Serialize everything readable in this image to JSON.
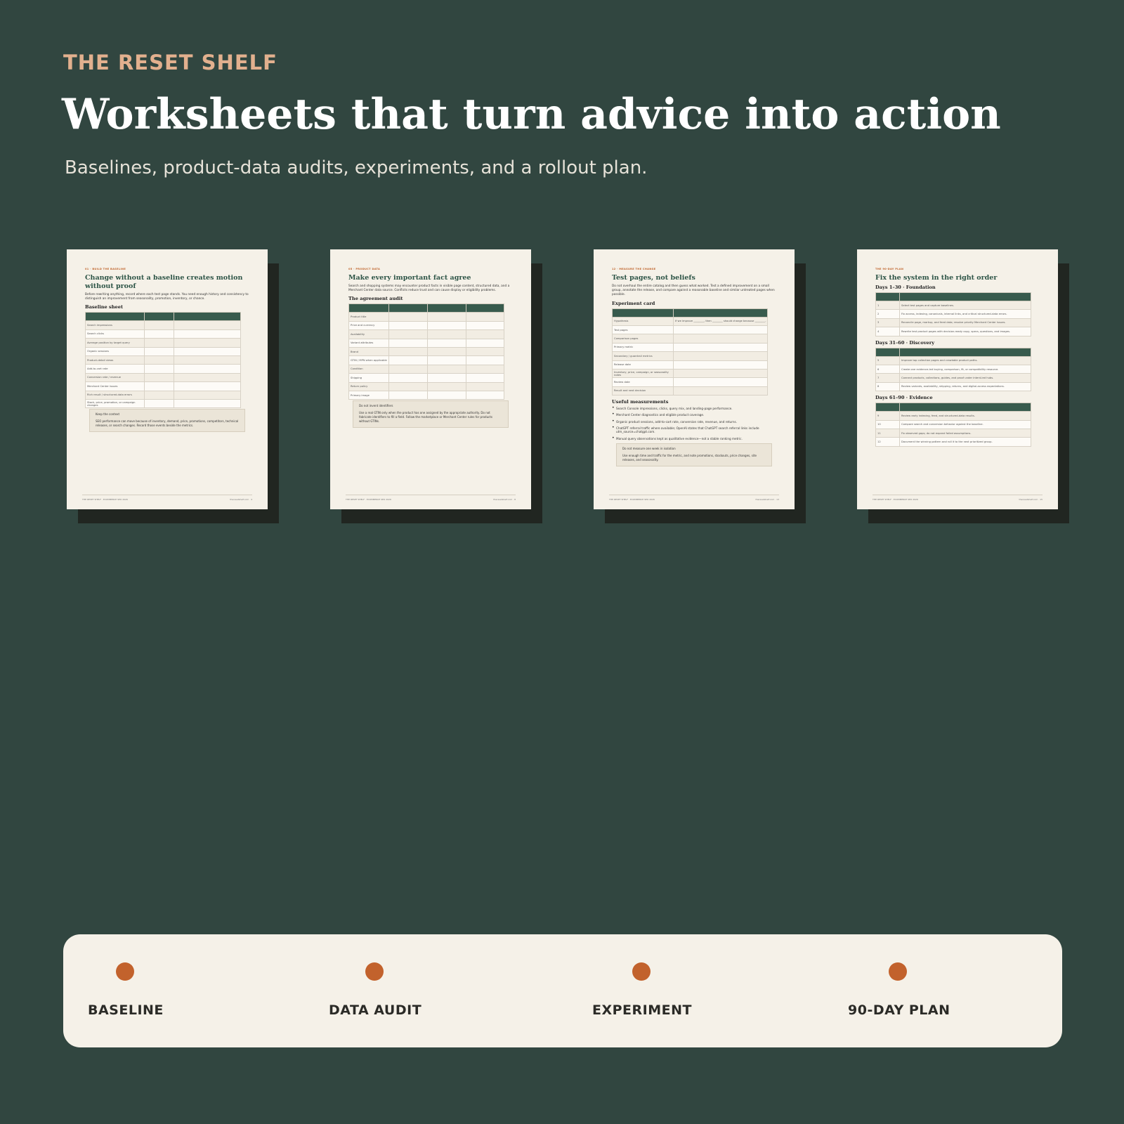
{
  "brand": "THE RESET SHELF",
  "headline": "Worksheets that turn advice into action",
  "subheadline": "Baselines, product-data audits, experiments, and a rollout plan.",
  "pages": [
    {
      "kicker": "01 · BUILD THE BASELINE",
      "title": "Change without a baseline creates motion without proof",
      "intro": "Before rewriting anything, record where each test page stands. You need enough history and consistency to distinguish an improvement from seasonality, promotion, inventory, or chance.",
      "section": "Baseline sheet",
      "rows": [
        "Search impressions",
        "Search clicks",
        "Average position by target query",
        "Organic sessions",
        "Product-detail views",
        "Add-to-cart rate",
        "Conversion rate / revenue",
        "Merchant Center issues",
        "Rich result / structured-data errors",
        "Stock, price, promotion, or campaign changes"
      ],
      "callout_title": "Keep the context",
      "callout_body": "SEO performance can move because of inventory, demand, price, promotions, competitors, technical releases, or search changes. Record those events beside the metrics.",
      "footer_left": "THE RESET SHELF · ECOMMERCE SEO 2026",
      "footer_right": "theresetshelf.com · 4"
    },
    {
      "kicker": "05 · PRODUCT DATA",
      "title": "Make every important fact agree",
      "intro": "Search and shopping systems may encounter product facts in visible page content, structured data, and a Merchant Center data source. Conflicts reduce trust and can cause display or eligibility problems.",
      "section": "The agreement audit",
      "rows": [
        "Product title",
        "Price and currency",
        "Availability",
        "Variant attributes",
        "Brand",
        "GTIN / MPN when applicable",
        "Condition",
        "Shipping",
        "Return policy",
        "Primary image"
      ],
      "callout_title": "Do not invent identifiers",
      "callout_body": "Use a real GTIN only when the product has one assigned by the appropriate authority. Do not fabricate identifiers to fill a field. Follow the marketplace or Merchant Center rules for products without GTINs.",
      "footer_left": "THE RESET SHELF · ECOMMERCE SEO 2026",
      "footer_right": "theresetshelf.com · 8"
    },
    {
      "kicker": "12 · MEASURE THE CHANGE",
      "title": "Test pages, not beliefs",
      "intro": "Do not overhaul the entire catalog and then guess what worked. Test a defined improvement on a small group, annotate the release, and compare against a reasonable baseline and similar untreated pages when possible.",
      "section": "Experiment card",
      "rows": [
        "Hypothesis",
        "Test pages",
        "Comparison pages",
        "Primary metric",
        "Secondary / guardrail metrics",
        "Release date",
        "Inventory, price, campaign, or seasonality notes",
        "Review date",
        "Result and next decision"
      ],
      "hypothesis_text": "If we improve ________, then ________ should change because ________.",
      "section2": "Useful measurements",
      "bullets": [
        "Search Console impressions, clicks, query mix, and landing-page performance.",
        "Merchant Center diagnostics and eligible product coverage.",
        "Organic product sessions, add-to-cart rate, conversion rate, revenue, and returns.",
        "ChatGPT referral traffic where available; OpenAI states that ChatGPT search referral links include utm_source=chatgpt.com.",
        "Manual query observations kept as qualitative evidence—not a stable ranking metric."
      ],
      "callout_title": "Do not measure one week in isolation",
      "callout_body": "Use enough time and traffic for the metric, and note promotions, stockouts, price changes, site releases, and seasonality.",
      "footer_left": "THE RESET SHELF · ECOMMERCE SEO 2026",
      "footer_right": "theresetshelf.com · 13"
    },
    {
      "kicker": "THE 90-DAY PLAN",
      "title": "Fix the system in the right order",
      "phases": [
        {
          "heading": "Days 1–30 · Foundation",
          "rows": [
            {
              "n": "1",
              "t": "Select test pages and capture baselines."
            },
            {
              "n": "2",
              "t": "Fix access, indexing, canonicals, internal links, and critical structured-data errors."
            },
            {
              "n": "3",
              "t": "Reconcile page, markup, and feed data; resolve priority Merchant Center issues."
            },
            {
              "n": "4",
              "t": "Rewrite test product pages with decision-ready copy, specs, questions, and images."
            }
          ]
        },
        {
          "heading": "Days 31–60 · Discovery",
          "rows": [
            {
              "n": "5",
              "t": "Improve top collection pages and crawlable product paths."
            },
            {
              "n": "6",
              "t": "Create one evidence-led buying, comparison, fit, or compatibility resource."
            },
            {
              "n": "7",
              "t": "Connect products, collections, guides, and proof under intent-led hubs."
            },
            {
              "n": "8",
              "t": "Review variants, availability, shipping, returns, and digital-access expectations."
            }
          ]
        },
        {
          "heading": "Days 61–90 · Evidence",
          "rows": [
            {
              "n": "9",
              "t": "Review early indexing, feed, and structured-data results."
            },
            {
              "n": "10",
              "t": "Compare search and conversion behavior against the baseline."
            },
            {
              "n": "11",
              "t": "Fix observed gaps; do not expand failed assumptions."
            },
            {
              "n": "12",
              "t": "Document the winning pattern and roll it to the next prioritized group."
            }
          ]
        }
      ],
      "footer_left": "THE RESET SHELF · ECOMMERCE SEO 2026",
      "footer_right": "theresetshelf.com · 15"
    }
  ],
  "stages": [
    "BASELINE",
    "DATA AUDIT",
    "EXPERIMENT",
    "90-DAY PLAN"
  ],
  "colors": {
    "background": "#314640",
    "accent": "#c2622c",
    "brand": "#e2b08e",
    "paper": "#f5f1e8",
    "table_header": "#385b4d"
  }
}
